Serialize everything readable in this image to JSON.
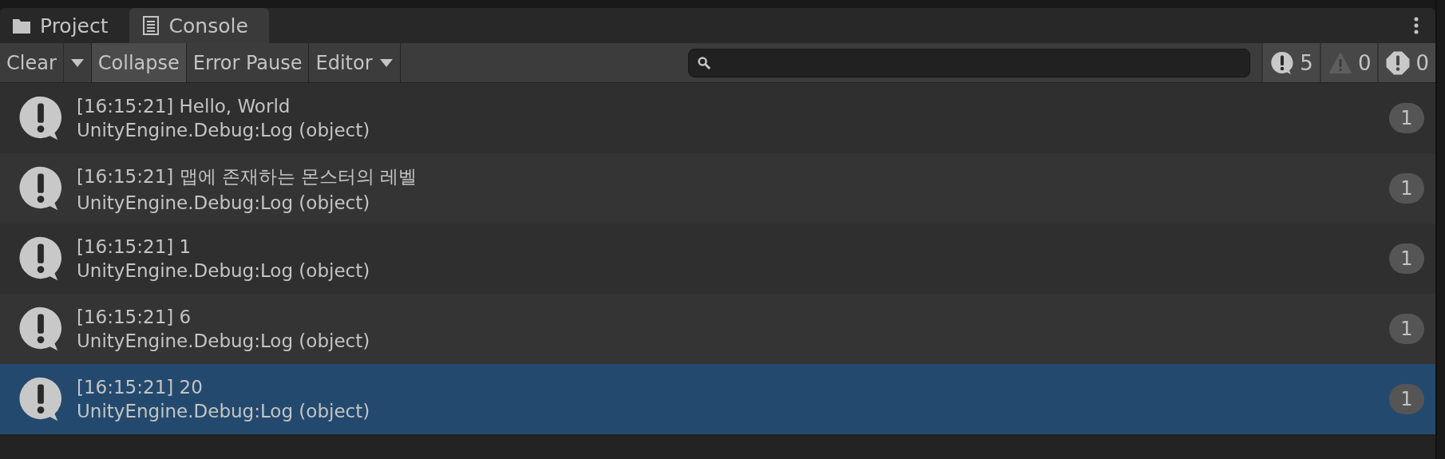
{
  "tabs": [
    {
      "label": "Project",
      "kind": "folder",
      "selected": false
    },
    {
      "label": "Console",
      "kind": "console",
      "selected": true
    }
  ],
  "toolbar": [
    {
      "label": "Clear",
      "kind": "split"
    },
    {
      "label": "Collapse",
      "kind": "toggle",
      "on": true
    },
    {
      "label": "Error Pause",
      "kind": "toggle",
      "on": false
    },
    {
      "label": "Editor",
      "kind": "dropdown"
    }
  ],
  "counters": [
    {
      "kind": "log",
      "count": "5"
    },
    {
      "kind": "warning",
      "count": "0"
    },
    {
      "kind": "error",
      "count": "0"
    }
  ],
  "entries": [
    {
      "message": "[16:15:21] Hello, World",
      "source": "UnityEngine.Debug:Log (object)",
      "count": "1",
      "selected": false
    },
    {
      "message": "[16:15:21] 맵에 존재하는 몬스터의 레벨",
      "source": "UnityEngine.Debug:Log (object)",
      "count": "1",
      "selected": false
    },
    {
      "message": "[16:15:21] 1",
      "source": "UnityEngine.Debug:Log (object)",
      "count": "1",
      "selected": false
    },
    {
      "message": "[16:15:21] 6",
      "source": "UnityEngine.Debug:Log (object)",
      "count": "1",
      "selected": false
    },
    {
      "message": "[16:15:21] 20",
      "source": "UnityEngine.Debug:Log (object)",
      "count": "1",
      "selected": true
    }
  ]
}
